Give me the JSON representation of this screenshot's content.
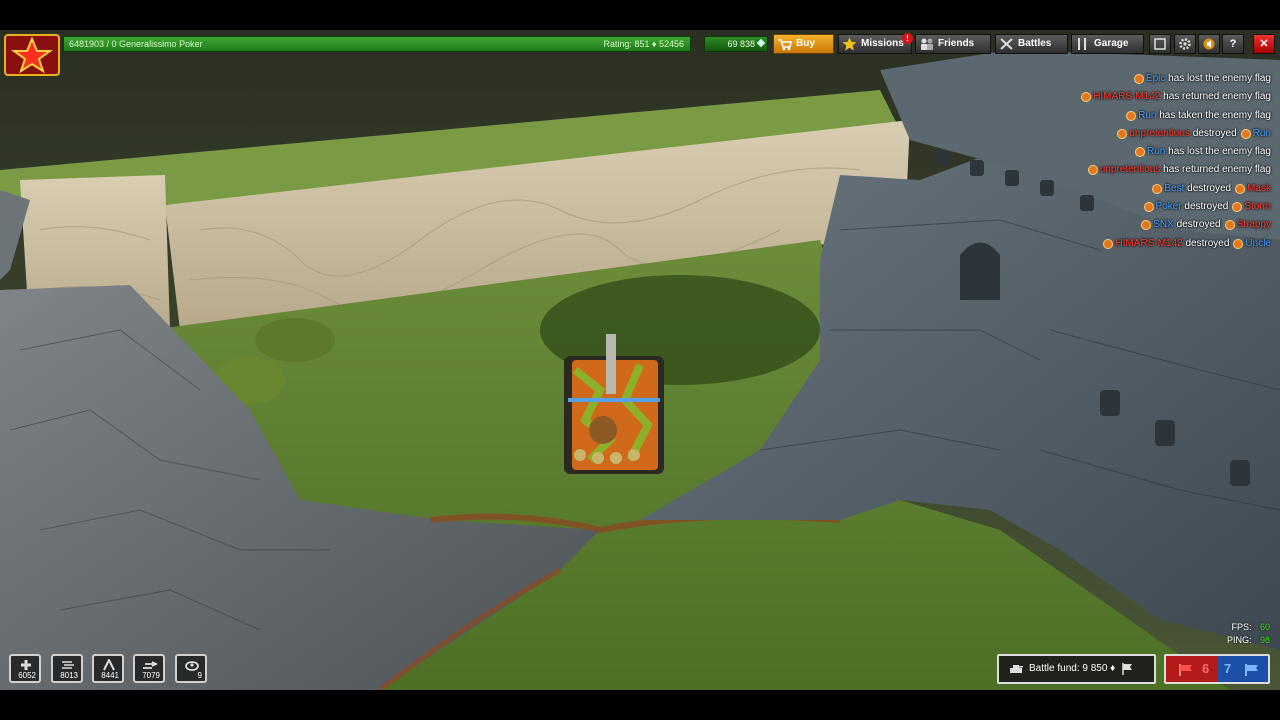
{
  "hud": {
    "player_line": "6481903 / 0  Generalissimo Poker",
    "rating_line": "Rating: 851  ♦ 52456",
    "crystals": "69 838",
    "progress_fraction": 1.0
  },
  "nav": {
    "buy": "Buy",
    "missions": "Missions",
    "missions_badge": "!",
    "friends": "Friends",
    "battles": "Battles",
    "garage": "Garage",
    "help": "?",
    "close": "✕"
  },
  "kill_feed": [
    {
      "left": "Epic",
      "left_team": "blue",
      "action": "has lost the enemy flag",
      "right": "",
      "right_team": ""
    },
    {
      "left": "HIMARS-M142",
      "left_team": "red",
      "action": "has returned enemy flag",
      "right": "",
      "right_team": ""
    },
    {
      "left": "Run",
      "left_team": "blue",
      "action": "has taken the enemy flag",
      "right": "",
      "right_team": ""
    },
    {
      "left": "unpretentious",
      "left_team": "red",
      "action": "destroyed",
      "right": "Run",
      "right_team": "blue"
    },
    {
      "left": "Run",
      "left_team": "blue",
      "action": "has lost the enemy flag",
      "right": "",
      "right_team": ""
    },
    {
      "left": "unpretentious",
      "left_team": "red",
      "action": "has returned enemy flag",
      "right": "",
      "right_team": ""
    },
    {
      "left": "Best",
      "left_team": "blue",
      "action": "destroyed",
      "right": "Mask",
      "right_team": "red"
    },
    {
      "left": "Poker",
      "left_team": "blue",
      "action": "destroyed",
      "right": "Storm",
      "right_team": "red"
    },
    {
      "left": "SNX",
      "left_team": "blue",
      "action": "destroyed",
      "right": "Strappy",
      "right_team": "red"
    },
    {
      "left": "HIMARS-M142",
      "left_team": "red",
      "action": "destroyed",
      "right": "Uncle",
      "right_team": "blue"
    }
  ],
  "supplies": [
    {
      "name": "repair-kit",
      "count": "6052"
    },
    {
      "name": "double-armor",
      "count": "8013"
    },
    {
      "name": "double-damage",
      "count": "8441"
    },
    {
      "name": "speed-boost",
      "count": "7079"
    },
    {
      "name": "mine",
      "count": "9"
    }
  ],
  "stats": {
    "fps_label": "FPS:",
    "fps_value": "60",
    "ping_label": "PING:",
    "ping_value": "98"
  },
  "battle_fund": "Battle fund: 9 850 ♦",
  "score": {
    "red": "6",
    "blue": "7"
  },
  "colors": {
    "red_team": "#ff3c30",
    "blue_team": "#4aa2ff",
    "xp_bar": "#3da833",
    "buy_button": "#f4b22c"
  }
}
